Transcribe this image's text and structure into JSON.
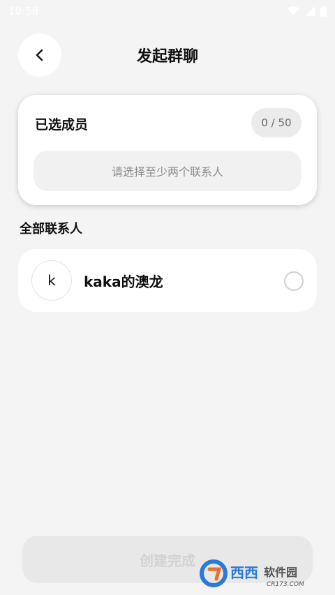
{
  "status_bar": {
    "time": "10:58"
  },
  "header": {
    "title": "发起群聊"
  },
  "selected": {
    "label": "已选成员",
    "count": "0 / 50",
    "hint": "请选择至少两个联系人"
  },
  "contacts": {
    "section_title": "全部联系人",
    "items": [
      {
        "avatar_letter": "k",
        "name": "kaka的澳龙",
        "selected": false
      }
    ]
  },
  "footer": {
    "create_label": "创建完成"
  },
  "watermark": {
    "brand": "西西软件园",
    "site": "CR173.COM"
  },
  "icons": {
    "back": "chevron-left-icon",
    "wifi": "wifi-icon",
    "signal": "signal-icon",
    "battery": "battery-icon"
  }
}
